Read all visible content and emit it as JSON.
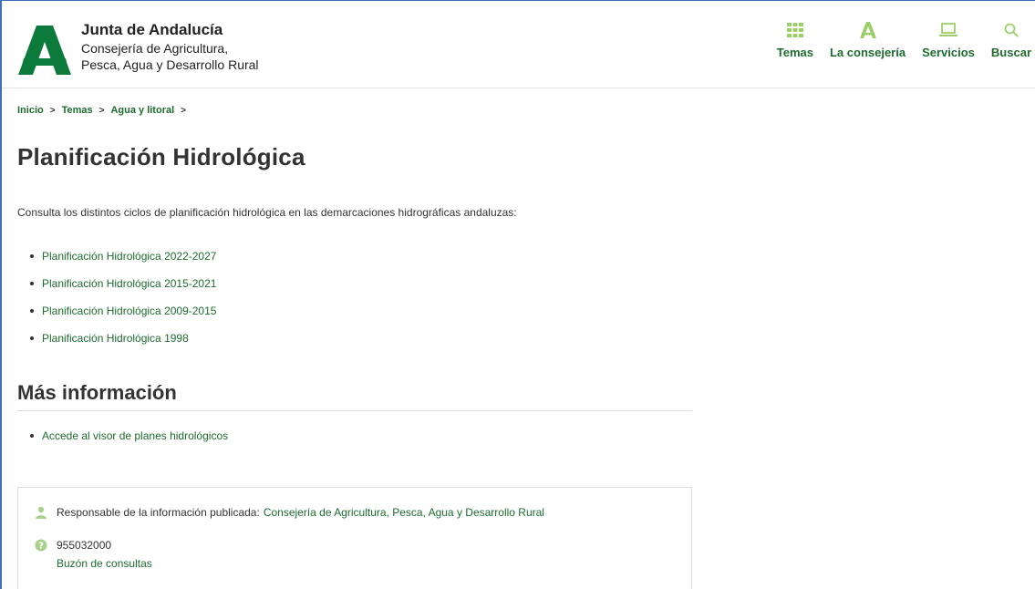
{
  "header": {
    "brand_title": "Junta de Andalucía",
    "brand_sub_1": "Consejería de Agricultura,",
    "brand_sub_2": "Pesca, Agua y Desarrollo Rural",
    "nav": [
      {
        "label": "Temas",
        "icon": "grid-icon"
      },
      {
        "label": "La consejería",
        "icon": "junta-a-icon"
      },
      {
        "label": "Servicios",
        "icon": "laptop-icon"
      },
      {
        "label": "Buscar",
        "icon": "search-icon"
      }
    ]
  },
  "breadcrumb": {
    "items": [
      "Inicio",
      "Temas",
      "Agua y litoral"
    ],
    "separator": ">"
  },
  "main": {
    "title": "Planificación Hidrológica",
    "intro": "Consulta los distintos ciclos de planificación hidrológica en las demarcaciones hidrográficas andaluzas:",
    "links": [
      "Planificación Hidrológica 2022-2027",
      "Planificación Hidrológica 2015-2021",
      "Planificación Hidrológica 2009-2015",
      "Planificación Hidrológica 1998"
    ],
    "more_title": "Más información",
    "more_links": [
      "Accede al visor de planes hidrológicos"
    ]
  },
  "info": {
    "responsible_label": "Responsable de la información publicada:",
    "responsible_link": "Consejería de Agricultura, Pesca, Agua y Desarrollo Rural",
    "phone": "955032000",
    "contact_link": "Buzón de consultas"
  },
  "colors": {
    "brand_green": "#1e6b2f",
    "icon_green": "#8cc63f",
    "frame_blue": "#3f6fb5"
  }
}
